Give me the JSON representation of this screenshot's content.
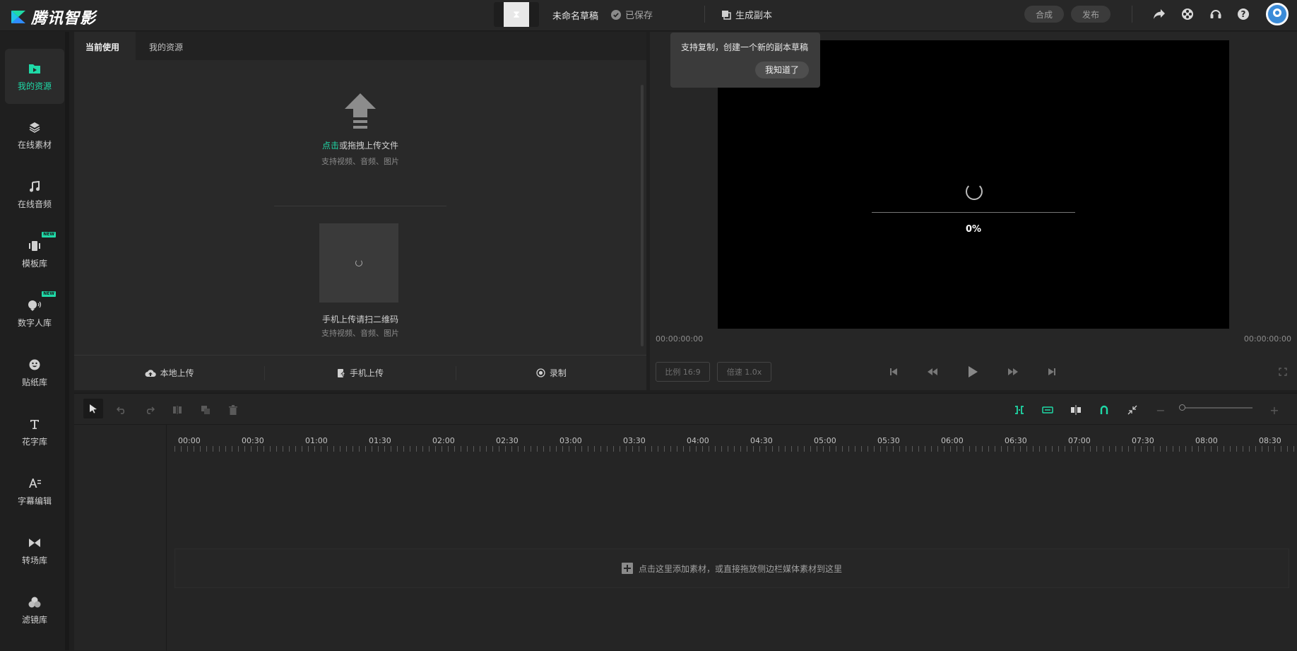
{
  "app": {
    "name": "腾讯智影",
    "accent": "#1fd9a7"
  },
  "topbar": {
    "draft_title": "未命名草稿",
    "saved_status": "已保存",
    "generate_copy": "生成副本",
    "compose_button": "合成",
    "publish_button": "发布",
    "icons": [
      "share-icon",
      "film-reel-icon",
      "headset-icon",
      "help-icon"
    ]
  },
  "sidebar": {
    "items": [
      {
        "label": "我的资源",
        "icon": "folder-play-icon",
        "active": true
      },
      {
        "label": "在线素材",
        "icon": "layers-icon"
      },
      {
        "label": "在线音频",
        "icon": "music-note-icon"
      },
      {
        "label": "模板库",
        "icon": "template-icon",
        "badge": "NEW"
      },
      {
        "label": "数字人库",
        "icon": "digital-human-icon",
        "badge": "NEW"
      },
      {
        "label": "贴纸库",
        "icon": "sticker-icon"
      },
      {
        "label": "花字库",
        "icon": "text-t-icon"
      },
      {
        "label": "字幕编辑",
        "icon": "subtitle-icon"
      },
      {
        "label": "转场库",
        "icon": "transition-icon"
      },
      {
        "label": "滤镜库",
        "icon": "filter-icon"
      }
    ]
  },
  "resources": {
    "tabs": [
      {
        "label": "当前使用",
        "active": true
      },
      {
        "label": "我的资源"
      }
    ],
    "upload": {
      "click_text": "点击",
      "drag_text": "或拖拽上传文件",
      "support_text": "支持视频、音频、图片"
    },
    "mobile": {
      "title": "手机上传请扫二维码",
      "support_text": "支持视频、音频、图片"
    },
    "actions": [
      "本地上传",
      "手机上传",
      "录制"
    ]
  },
  "preview": {
    "progress": "0%",
    "time_current": "00:00:00:00",
    "time_total": "00:00:00:00",
    "ratio": "比例 16:9",
    "speed": "倍速 1.0x",
    "tooltip": {
      "text": "支持复制，创建一个新的副本草稿",
      "button": "我知道了"
    }
  },
  "timeline": {
    "ruler": [
      "00:00",
      "00:30",
      "01:00",
      "01:30",
      "02:00",
      "02:30",
      "03:00",
      "03:30",
      "04:00",
      "04:30",
      "05:00",
      "05:30",
      "06:00",
      "06:30",
      "07:00",
      "07:30",
      "08:00",
      "08:30"
    ],
    "drop_hint": "点击这里添加素材，或直接拖放侧边栏媒体素材到这里",
    "zoom_minus": "−",
    "zoom_plus": "+"
  }
}
